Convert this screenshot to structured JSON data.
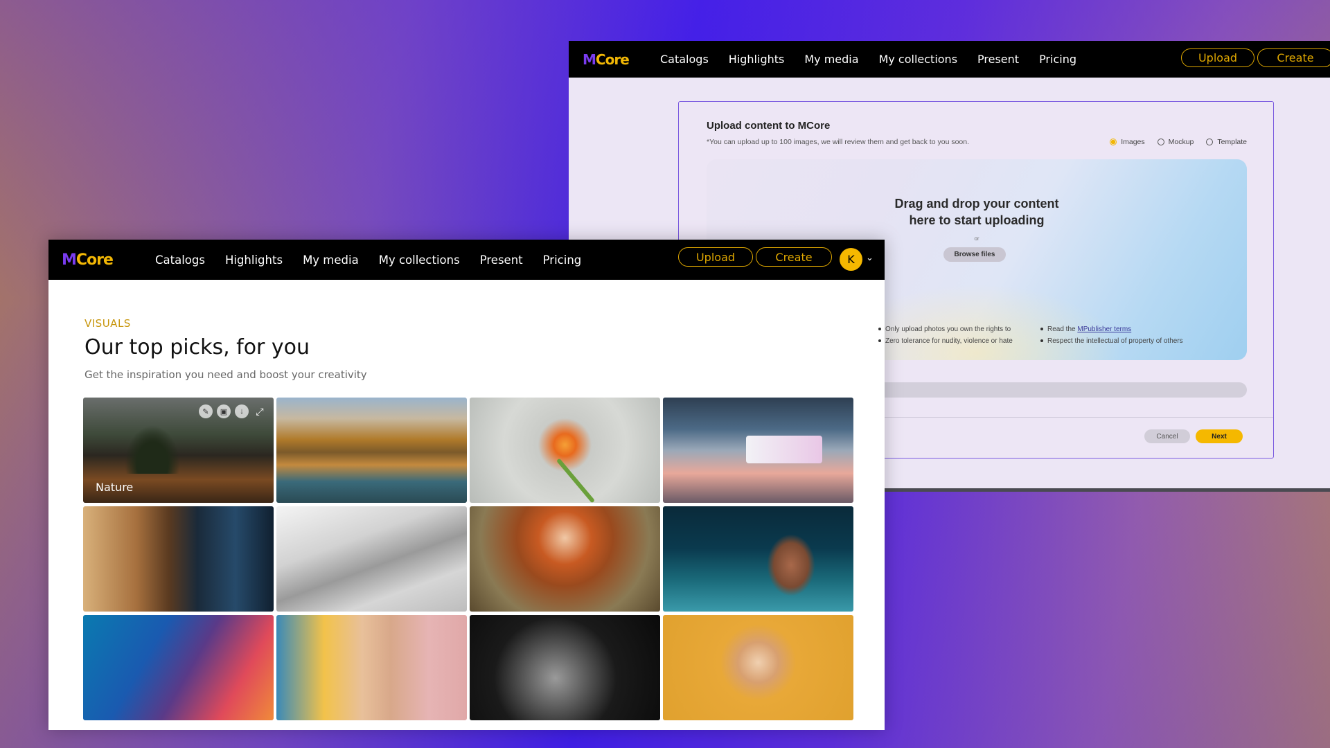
{
  "app": {
    "logo_m": "M",
    "logo_rest": "Core",
    "nav": [
      "Catalogs",
      "Highlights",
      "My media",
      "My collections",
      "Present",
      "Pricing"
    ],
    "upload_label": "Upload",
    "create_label": "Create",
    "avatar_initial": "K",
    "colors": {
      "accent": "#f5b800",
      "logo_m": "#7a3cf0",
      "nav_bg": "#000000"
    }
  },
  "upload_dialog": {
    "title": "Upload content to MCore",
    "subtitle": "*You can upload up to 100 images, we will review them and get back to you soon.",
    "radio_options": [
      "Images",
      "Mockup",
      "Template"
    ],
    "selected_option": "Images",
    "dropzone_title_line1": "Drag and drop your content",
    "dropzone_title_line2": "here to start uploading",
    "or_label": "or",
    "browse_label": "Browse files",
    "rules_left": [
      "Only upload photos you own the rights to",
      "Zero tolerance for nudity, violence or hate"
    ],
    "rules_right_prefix": "Read the ",
    "rules_right_link": "MPublisher terms",
    "rules_right_2": "Respect the intellectual of property of others",
    "cancel_label": "Cancel",
    "next_label": "Next"
  },
  "visuals": {
    "eyebrow": "VISUALS",
    "title": "Our top picks, for you",
    "subtitle": "Get the inspiration you need and boost your creativity",
    "tiles": [
      {
        "label": "Nature",
        "image": "mountain-lake-dusk"
      },
      {
        "label": "",
        "image": "autumn-mountain-lake"
      },
      {
        "label": "",
        "image": "orange-tulip"
      },
      {
        "label": "",
        "image": "futuristic-office-desk"
      },
      {
        "label": "",
        "image": "woman-coding"
      },
      {
        "label": "",
        "image": "desert-dunes-bw"
      },
      {
        "label": "",
        "image": "red-hair-woman"
      },
      {
        "label": "",
        "image": "swimmer"
      },
      {
        "label": "",
        "image": "curly-hair-profile"
      },
      {
        "label": "",
        "image": "young-man-pink-wall"
      },
      {
        "label": "",
        "image": "boy-hat-bw"
      },
      {
        "label": "",
        "image": "smiling-woman-glasses"
      }
    ],
    "tile_actions": [
      "edit-icon",
      "save-icon",
      "download-icon",
      "expand-icon"
    ]
  }
}
